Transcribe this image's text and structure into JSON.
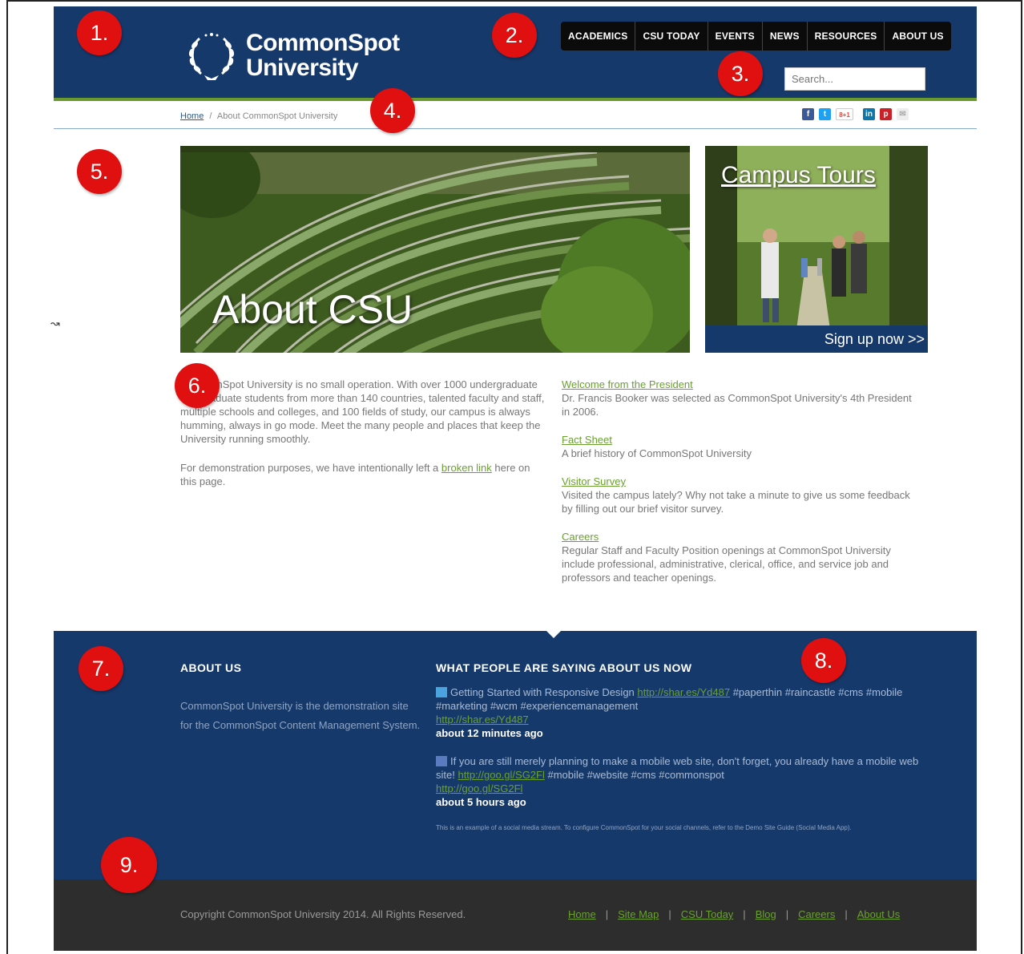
{
  "header": {
    "logo_line1": "CommonSpot",
    "logo_line2": "University",
    "nav": [
      "ACADEMICS",
      "CSU TODAY",
      "EVENTS",
      "NEWS",
      "RESOURCES",
      "ABOUT US"
    ],
    "search_placeholder": "Search..."
  },
  "breadcrumb": {
    "home": "Home",
    "separator": "/",
    "current": "About CommonSpot University"
  },
  "social": [
    "f",
    "t",
    "8+1",
    "in",
    "p",
    "✉"
  ],
  "hero": {
    "title": "About CSU"
  },
  "tours": {
    "title": "Campus Tours",
    "cta": "Sign up now >>"
  },
  "intro": {
    "p1": "CommonSpot University is no small operation. With over 1000 undergraduate and graduate students from more than 140 countries, talented faculty and staff, multiple schools and colleges, and 100 fields of study, our campus is always humming, always in go mode. Meet the many people and places that keep the University running smoothly.",
    "p2_before": "For demonstration purposes, we have intentionally left a",
    "p2_link": "broken link",
    "p2_after": "here on this page."
  },
  "links": [
    {
      "title": "Welcome from the President",
      "desc": "Dr. Francis Booker was selected as CommonSpot University's 4th President in 2006."
    },
    {
      "title": "Fact Sheet",
      "desc": "A brief history of CommonSpot University"
    },
    {
      "title": "Visitor Survey",
      "desc": "Visited the campus lately? Why not take a minute to give us some feedback by filling out our brief visitor survey."
    },
    {
      "title": "Careers",
      "desc": "Regular Staff and Faculty Position openings at CommonSpot University include professional, administrative, clerical, office, and service job and professors and teacher openings."
    }
  ],
  "footer": {
    "about_heading": "ABOUT US",
    "about_text": "CommonSpot University is the demonstration site for the CommonSpot Content Management System.",
    "feed_heading": "WHAT PEOPLE ARE SAYING ABOUT US NOW",
    "tweets": [
      {
        "text_before": "Getting Started with Responsive Design",
        "link1": "http://shar.es/Yd487",
        "text_after": "#paperthin #raincastle #cms #mobile #marketing #wcm #experiencemanagement",
        "link2": "http://shar.es/Yd487",
        "time": "about 12 minutes ago"
      },
      {
        "text_before": "If you are still merely planning to make a mobile web site, don't forget, you already have a mobile web site!",
        "link1": "http://goo.gl/SG2Fl",
        "text_after": "#mobile #website #cms #commonspot",
        "link2": "http://goo.gl/SG2Fl",
        "time": "about 5 hours ago"
      }
    ],
    "note": "This is an example of a social media stream. To configure CommonSpot for your social channels, refer to the Demo Site Guide (Social Media App)."
  },
  "bottom": {
    "copyright": "Copyright CommonSpot University 2014. All Rights Reserved.",
    "links": [
      "Home",
      "Site Map",
      "CSU Today",
      "Blog",
      "Careers",
      "About Us"
    ],
    "separator": "|"
  },
  "markers": [
    "1.",
    "2.",
    "3.",
    "4.",
    "5.",
    "6.",
    "7.",
    "8.",
    "9."
  ],
  "colors": {
    "brand_blue": "#16396b",
    "accent_green": "#6aa030",
    "marker_red": "#e01010",
    "footer_dark": "#2d2d2d"
  }
}
